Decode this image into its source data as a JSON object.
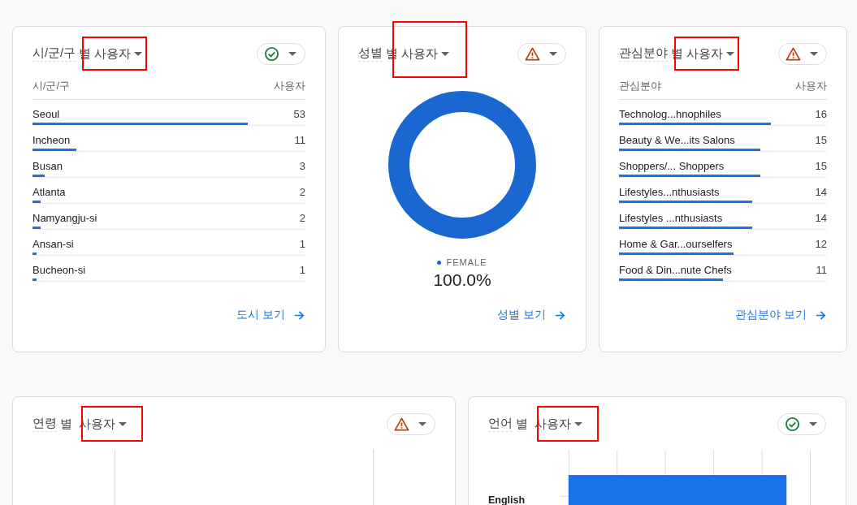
{
  "cards": [
    {
      "kind": "table",
      "dimension": "시/군/구",
      "by": "별",
      "metric": "사용자",
      "highlighted": true,
      "warning": false,
      "columns": [
        "시/군/구",
        "사용자"
      ],
      "rows": [
        {
          "name": "Seoul",
          "value": "53",
          "level": 0.79
        },
        {
          "name": "Incheon",
          "value": "11",
          "level": 0.16
        },
        {
          "name": "Busan",
          "value": "3",
          "level": 0.045
        },
        {
          "name": "Atlanta",
          "value": "2",
          "level": 0.03
        },
        {
          "name": "Namyangju-si",
          "value": "2",
          "level": 0.03
        },
        {
          "name": "Ansan-si",
          "value": "1",
          "level": 0.015
        },
        {
          "name": "Bucheon-si",
          "value": "1",
          "level": 0.015
        }
      ],
      "link": "도시 보기"
    },
    {
      "kind": "donut",
      "dimension": "성별",
      "by": "별",
      "metric": "사용자",
      "highlighted": true,
      "warning": true,
      "legend": "FEMALE",
      "percent": "100.0%",
      "link": "성별 보기"
    },
    {
      "kind": "table",
      "dimension": "관심분야",
      "by": "별",
      "metric": "사용자",
      "highlighted": true,
      "warning": true,
      "columns": [
        "관심분야",
        "사용자"
      ],
      "rows": [
        {
          "name": "Technolog...hnophiles",
          "value": "16",
          "level": 0.73
        },
        {
          "name": "Beauty & We...its Salons",
          "value": "15",
          "level": 0.68
        },
        {
          "name": "Shoppers/... Shoppers",
          "value": "15",
          "level": 0.68
        },
        {
          "name": "Lifestyles...nthusiasts",
          "value": "14",
          "level": 0.64
        },
        {
          "name": "Lifestyles ...nthusiasts",
          "value": "14",
          "level": 0.64
        },
        {
          "name": "Home & Gar...ourselfers",
          "value": "12",
          "level": 0.55
        },
        {
          "name": "Food & Din...nute Chefs",
          "value": "11",
          "level": 0.5
        }
      ],
      "link": "관심분야 보기"
    },
    {
      "kind": "age",
      "dimension": "연령",
      "by": "별",
      "metric": "사용자",
      "highlighted": true,
      "warning": true
    },
    {
      "kind": "language",
      "dimension": "언어",
      "by": "별",
      "metric": "사용자",
      "highlighted": true,
      "warning": false,
      "label": "English"
    }
  ]
}
